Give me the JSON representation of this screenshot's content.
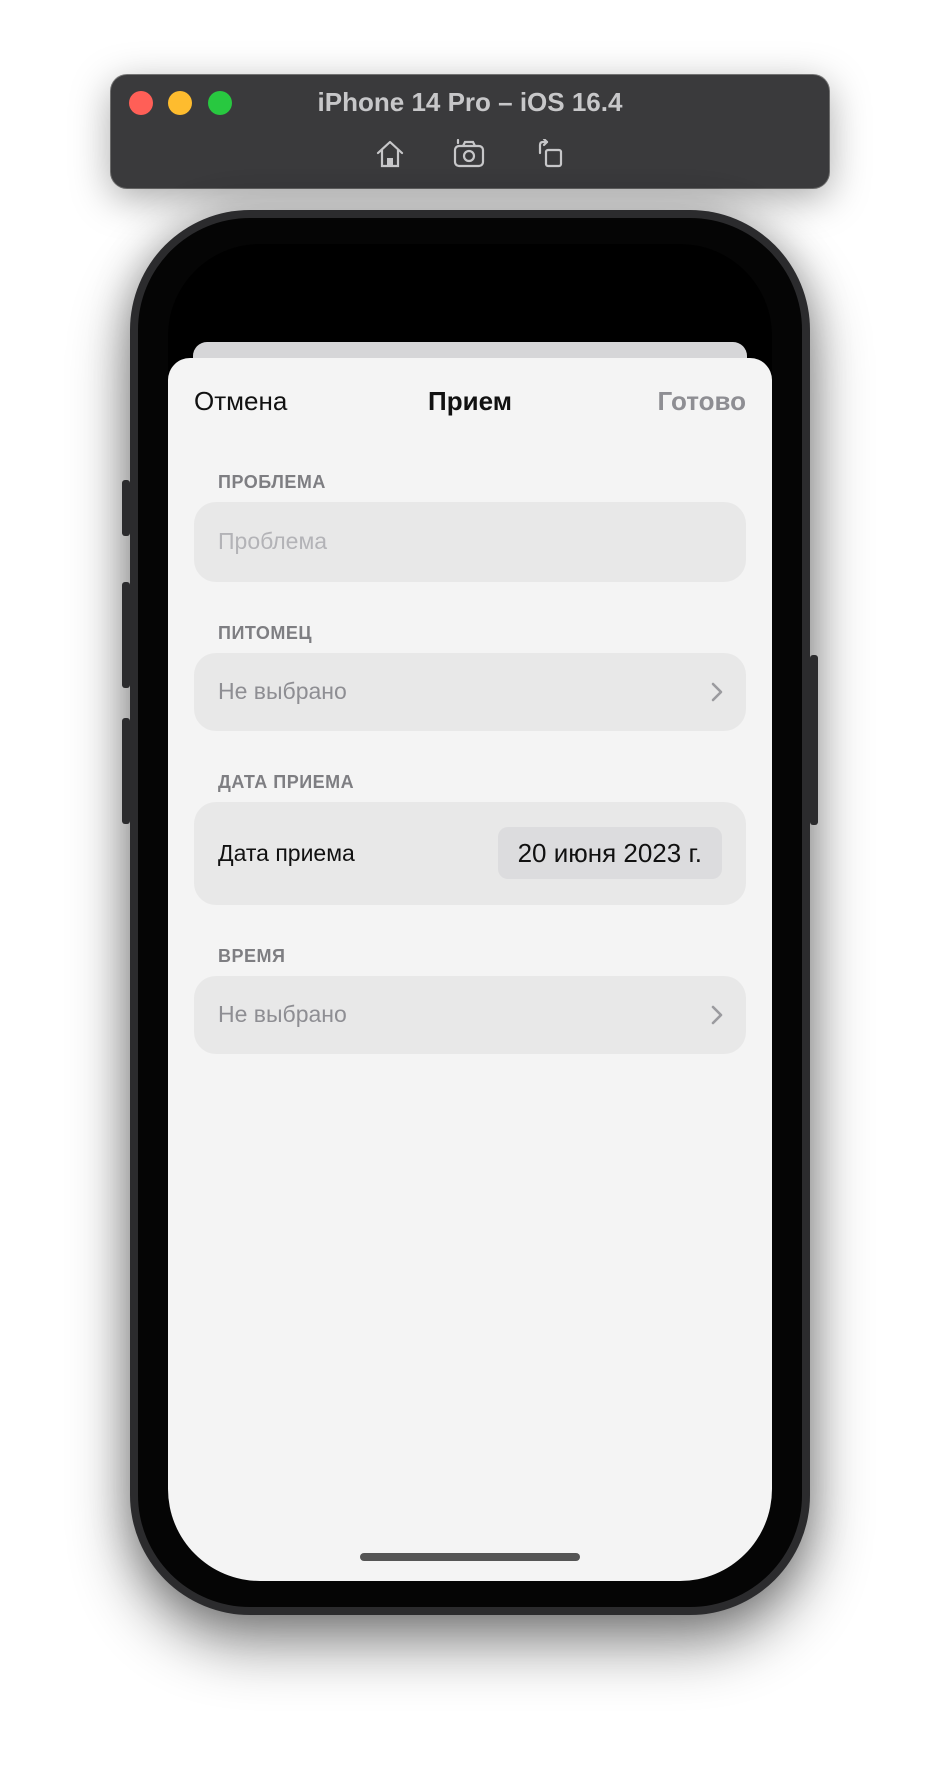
{
  "simulator": {
    "title": "iPhone 14 Pro – iOS 16.4",
    "icons": [
      "home-icon",
      "screenshot-icon",
      "rotate-icon"
    ]
  },
  "nav": {
    "cancel_label": "Отмена",
    "title": "Прием",
    "done_label": "Готово"
  },
  "form": {
    "problem": {
      "section_label": "ПРОБЛЕМА",
      "placeholder": "Проблема",
      "value": ""
    },
    "pet": {
      "section_label": "ПИТОМЕЦ",
      "value": "Не выбрано"
    },
    "date": {
      "section_label": "ДАТА ПРИЕМА",
      "label": "Дата приема",
      "value": "20 июня 2023 г."
    },
    "time": {
      "section_label": "ВРЕМЯ",
      "value": "Не выбрано"
    }
  }
}
